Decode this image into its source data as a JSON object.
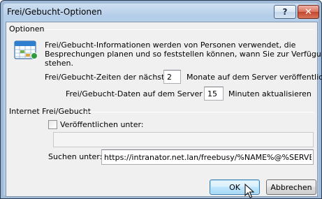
{
  "window": {
    "title": "Frei/Gebucht-Optionen",
    "help_glyph": "?",
    "close_glyph": "✕"
  },
  "options_group": {
    "label": "Optionen",
    "description_line1": "Frei/Gebucht-Informationen werden von Personen verwendet, die",
    "description_line2": "Besprechungen planen und so feststellen können, wann Sie zur Verfügung",
    "description_line3": "stehen.",
    "months_prefix": "Frei/Gebucht-Zeiten der nächsten",
    "months_value": "2",
    "months_suffix": "Monate auf dem Server veröffentlichen",
    "minutes_prefix": "Frei/Gebucht-Daten auf dem Server alle",
    "minutes_value": "15",
    "minutes_suffix": "Minuten aktualisieren"
  },
  "internet_group": {
    "label": "Internet Frei/Gebucht",
    "publish_label": "Veröffentlichen unter:",
    "publish_checked": false,
    "publish_url": "",
    "search_label": "Suchen unter:",
    "search_url": "https://intranator.net.lan/freebusy/%NAME%@%SERVER%.ifb"
  },
  "buttons": {
    "ok": "OK",
    "cancel": "Abbrechen"
  },
  "colors": {
    "title_bar": "#b4cde8",
    "close_button": "#c2462e",
    "dialog_background": "#f0f0f0"
  },
  "icons": {
    "calendar": "calendar-icon",
    "cursor": "mouse-pointer-icon"
  }
}
